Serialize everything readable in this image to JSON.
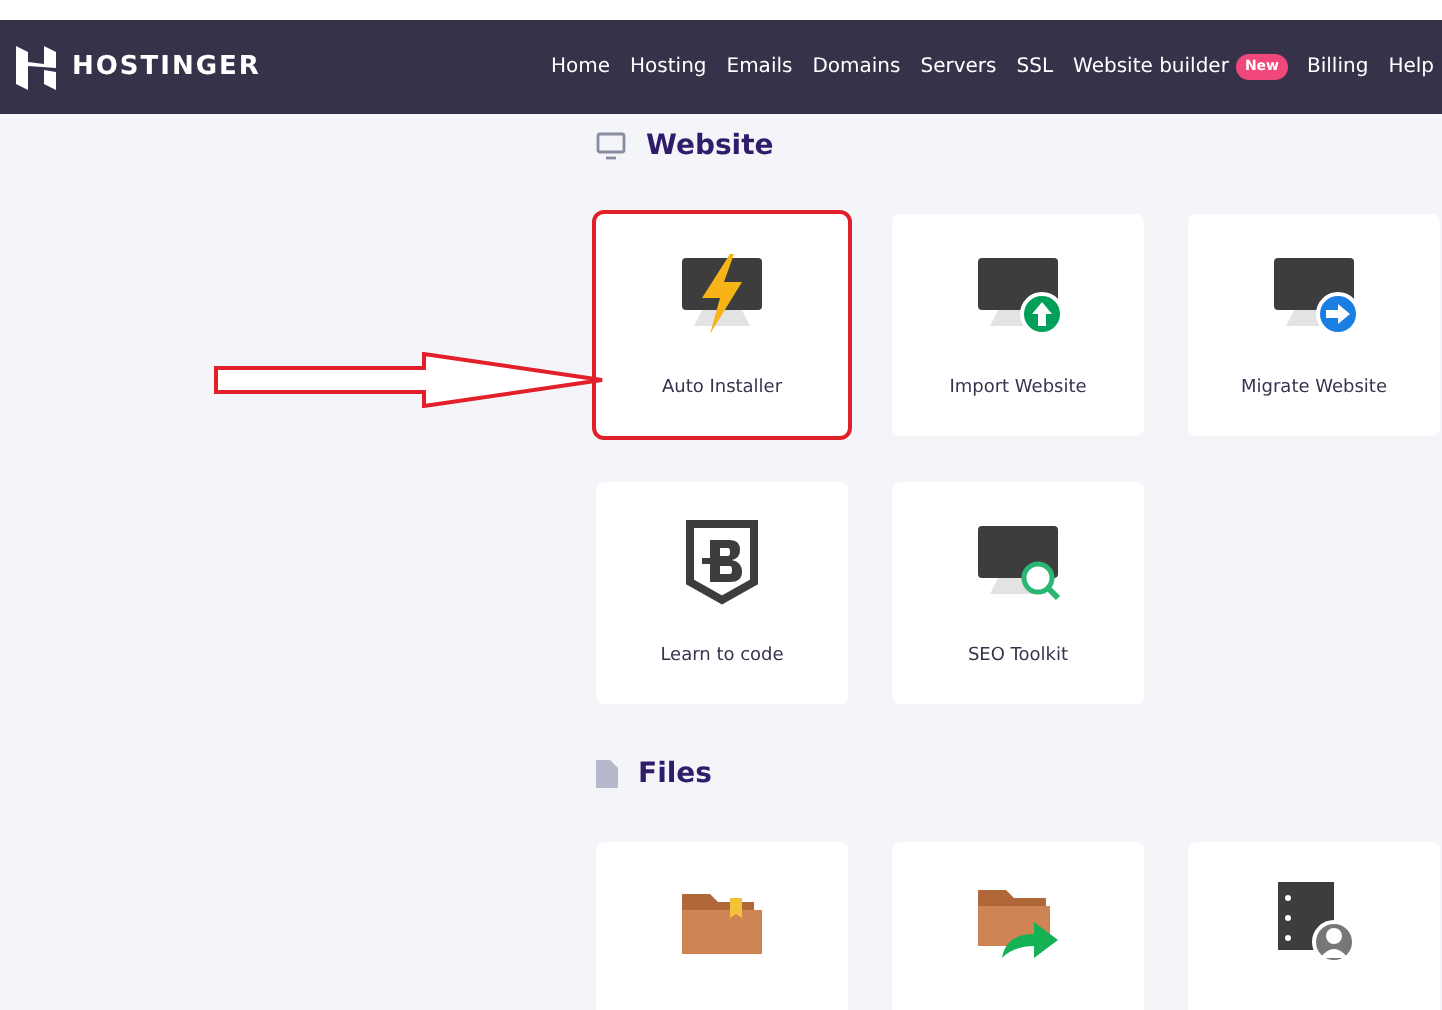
{
  "navbar": {
    "brand": "HOSTINGER",
    "links": [
      {
        "label": "Home"
      },
      {
        "label": "Hosting"
      },
      {
        "label": "Emails"
      },
      {
        "label": "Domains"
      },
      {
        "label": "Servers"
      },
      {
        "label": "SSL"
      },
      {
        "label": "Website builder",
        "badge": "New"
      },
      {
        "label": "Billing"
      },
      {
        "label": "Help"
      }
    ]
  },
  "sections": [
    {
      "title": "Website",
      "kind": "monitor",
      "cards": [
        {
          "label": "Auto Installer",
          "kind": "bolt",
          "highlighted": true
        },
        {
          "label": "Import Website",
          "kind": "import",
          "highlighted": false
        },
        {
          "label": "Migrate Website",
          "kind": "migrate",
          "highlighted": false
        },
        {
          "label": "Learn to code",
          "kind": "shield",
          "highlighted": false
        },
        {
          "label": "SEO Toolkit",
          "kind": "seo",
          "highlighted": false
        }
      ]
    },
    {
      "title": "Files",
      "kind": "file",
      "cards": [
        {
          "kind": "folder",
          "highlighted": false
        },
        {
          "kind": "backup",
          "highlighted": false
        },
        {
          "kind": "ftp",
          "highlighted": false
        }
      ]
    }
  ]
}
